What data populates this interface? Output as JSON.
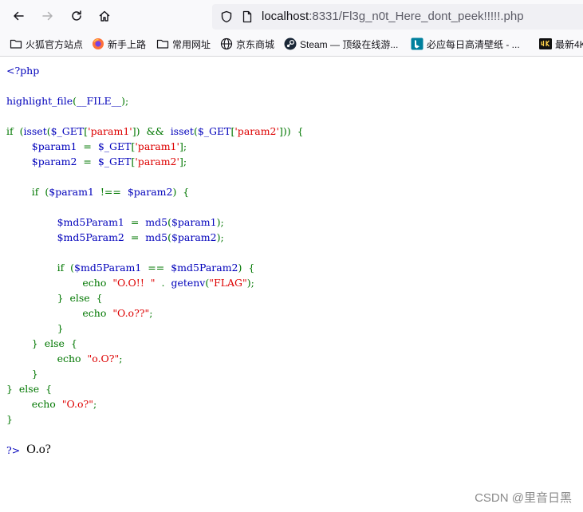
{
  "browser": {
    "nav": {
      "back_icon": "arrow-left-icon",
      "forward_icon": "arrow-right-icon",
      "reload_icon": "reload-icon",
      "home_icon": "home-icon"
    },
    "url": {
      "host": "localhost",
      "rest": ":8331/Fl3g_n0t_Here_dont_peek!!!!!.php"
    },
    "bookmarks": [
      {
        "icon": "folder-icon",
        "label": "火狐官方站点"
      },
      {
        "icon": "firefox-icon",
        "label": "新手上路"
      },
      {
        "icon": "folder-icon",
        "label": "常用网址"
      },
      {
        "icon": "globe-icon",
        "label": "京东商城"
      },
      {
        "icon": "steam-icon",
        "label": "Steam — 顶级在线游..."
      },
      {
        "icon": "bing-icon",
        "label": "必应每日高清壁纸 - ..."
      },
      {
        "icon": "4k-icon",
        "label": "最新4K"
      }
    ]
  },
  "source": {
    "lines": [
      "<?php",
      "",
      "highlight_file(__FILE__);",
      "",
      "if  (isset($_GET['param1'])  &&  isset($_GET['param2']))  {",
      "        $param1  =  $_GET['param1'];",
      "        $param2  =  $_GET['param2'];",
      "",
      "        if  ($param1  !==  $param2)  {",
      "",
      "                $md5Param1  =  md5($param1);",
      "                $md5Param2  =  md5($param2);",
      "",
      "                if  ($md5Param1  ==  $md5Param2)  {",
      "                        echo  \"O.O!!  \"  .  getenv(\"FLAG\");",
      "                }  else  {",
      "                        echo  \"O.o??\";",
      "                }",
      "        }  else  {",
      "                echo  \"o.O?\";",
      "        }",
      "}  else  {",
      "        echo  \"O.o?\";",
      "}"
    ],
    "closing_tag": "?>",
    "output": "O.o?"
  },
  "watermark": "CSDN @里音日黑",
  "colors": {
    "keyword": "#007700",
    "default": "#0000bb",
    "string": "#dd0000"
  }
}
